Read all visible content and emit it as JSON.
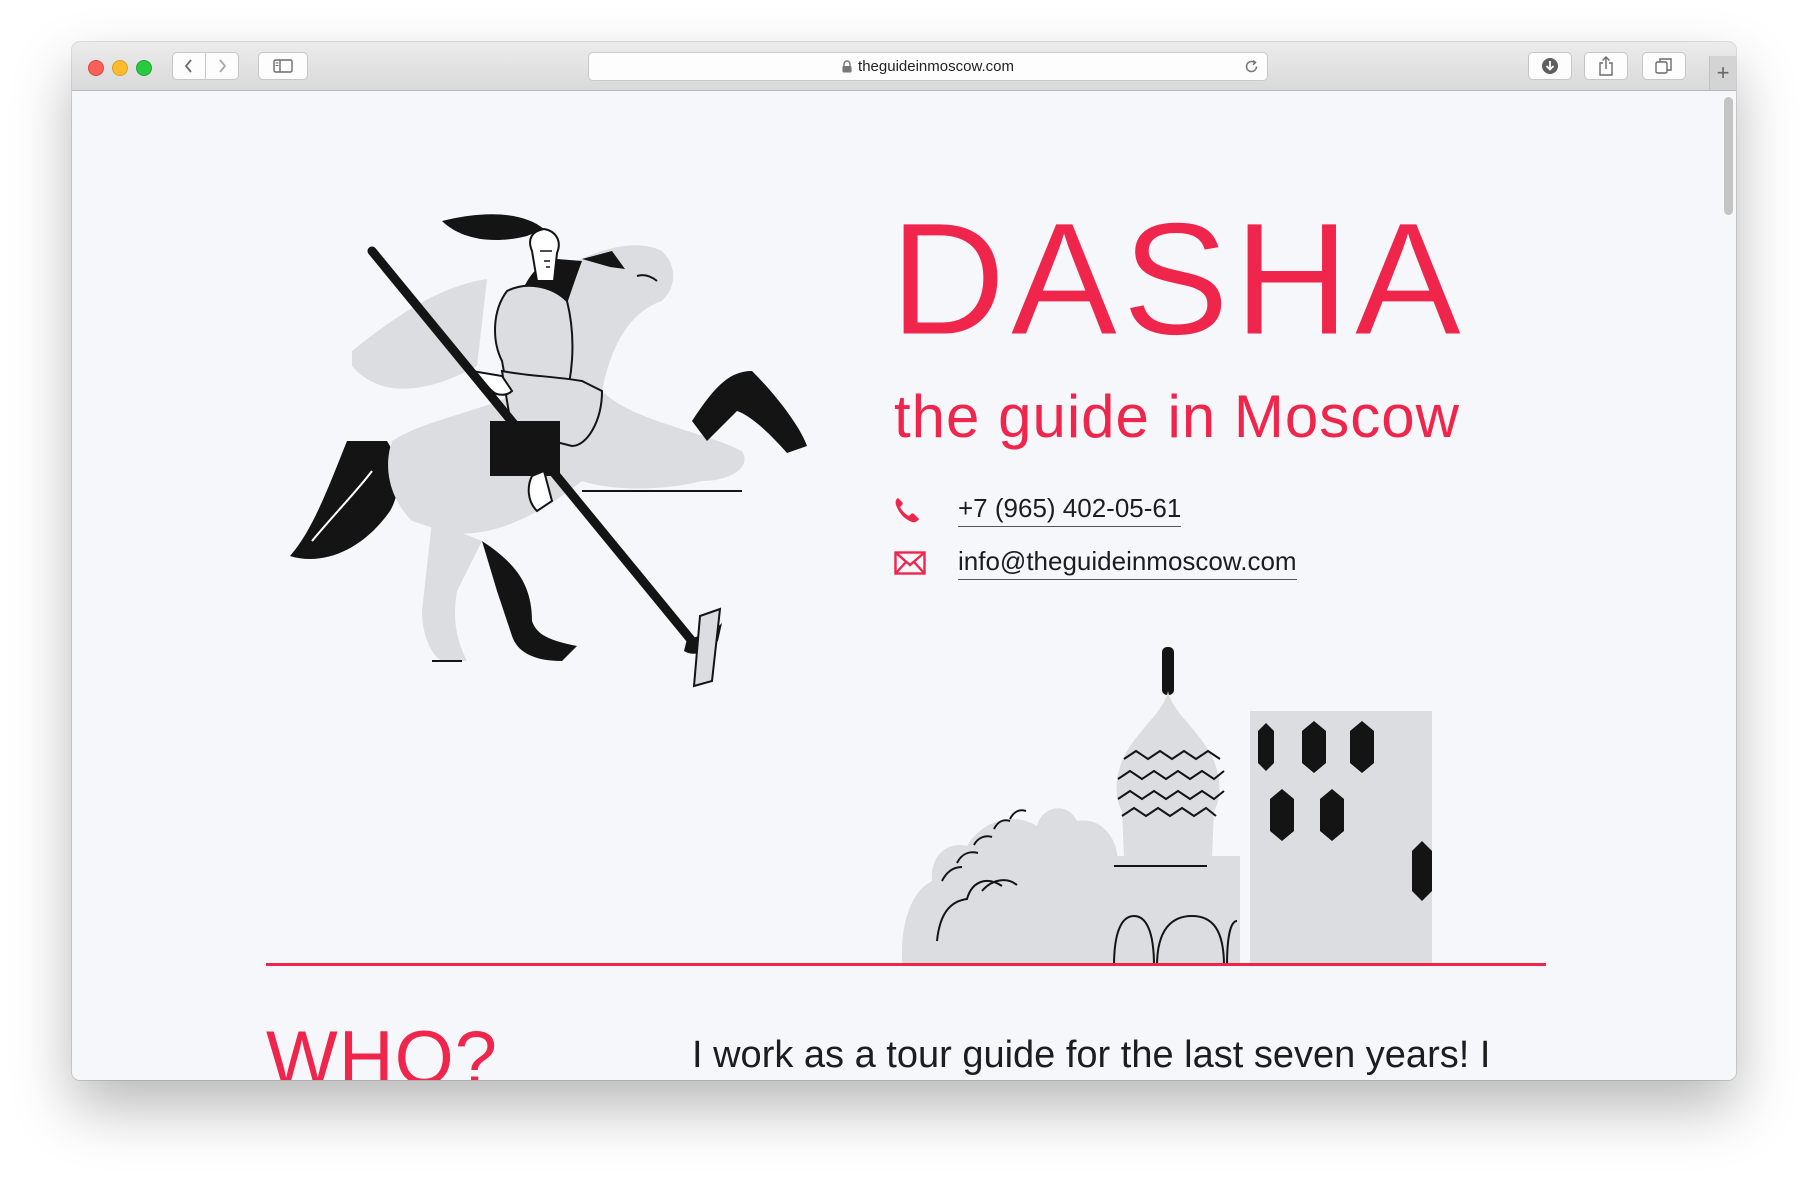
{
  "browser": {
    "url": "theguideinmoscow.com",
    "icons": {
      "back": "chevron-left-icon",
      "forward": "chevron-right-icon",
      "sidebar": "sidebar-icon",
      "lock": "lock-icon",
      "reload": "reload-icon",
      "download": "download-icon",
      "share": "share-icon",
      "tabs": "tabs-icon",
      "new_tab": "+"
    }
  },
  "hero": {
    "title": "DASHA",
    "subtitle": "the guide in Moscow",
    "phone": "+7 (965) 402-05-61",
    "email": "info@theguideinmoscow.com"
  },
  "about": {
    "heading": "WHO?",
    "text": "I work as a tour guide for the last seven years! I have two degrees: one in"
  },
  "colors": {
    "accent": "#f0254c",
    "background": "#f6f7fa",
    "illustration_gray": "#dcdde0",
    "text": "#1d1d1f"
  }
}
